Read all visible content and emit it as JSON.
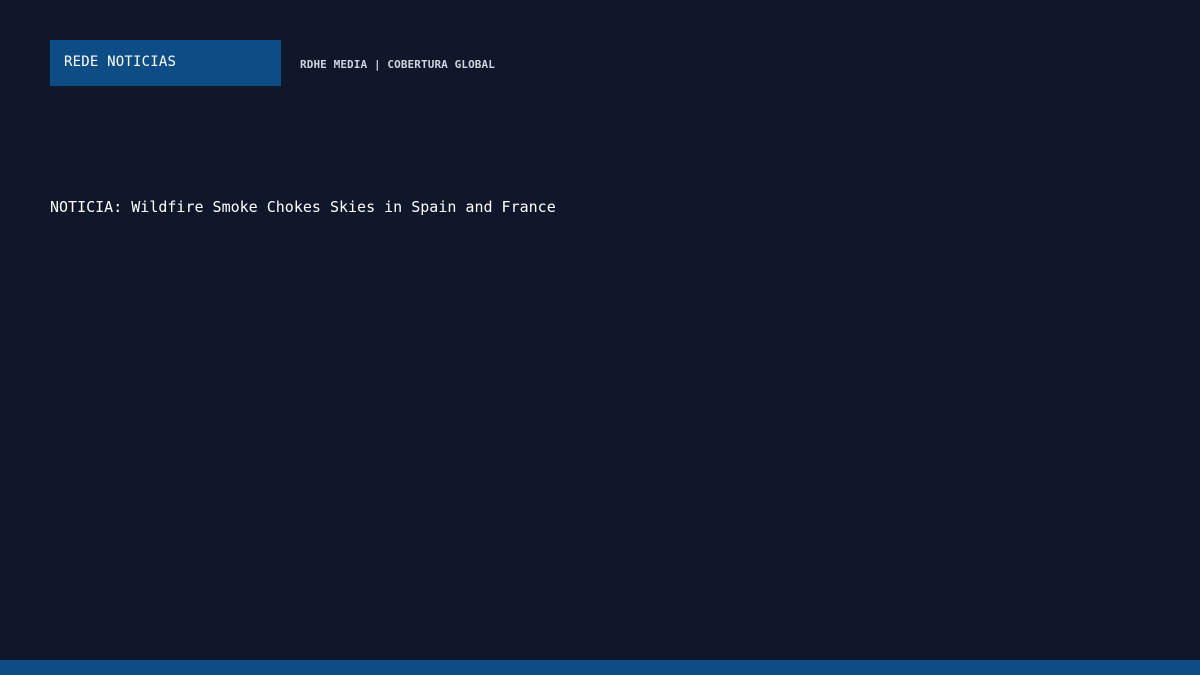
{
  "brand": {
    "name": "REDE NOTICIAS",
    "tagline": "RDHE MEDIA | COBERTURA GLOBAL"
  },
  "story": {
    "headline": "NOTICIA: Wildfire Smoke Chokes Skies in Spain and France"
  },
  "colors": {
    "background": "#0f172a",
    "accent": "#0e4c85",
    "text": "#ffffff",
    "muted_text": "#cbd5e1"
  }
}
